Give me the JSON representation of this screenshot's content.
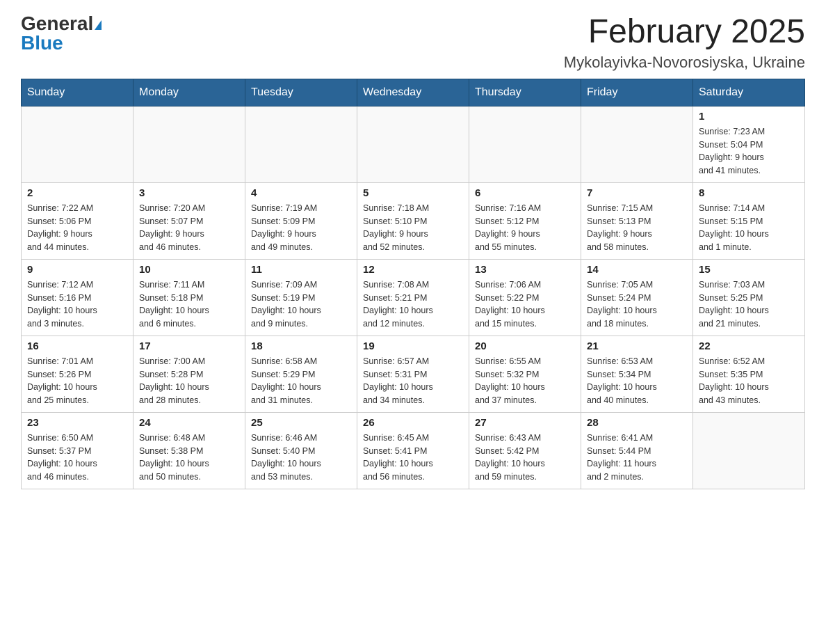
{
  "header": {
    "logo_general": "General",
    "logo_blue": "Blue",
    "title": "February 2025",
    "subtitle": "Mykolayivka-Novorosiyska, Ukraine"
  },
  "weekdays": [
    "Sunday",
    "Monday",
    "Tuesday",
    "Wednesday",
    "Thursday",
    "Friday",
    "Saturday"
  ],
  "weeks": [
    [
      {
        "day": "",
        "info": ""
      },
      {
        "day": "",
        "info": ""
      },
      {
        "day": "",
        "info": ""
      },
      {
        "day": "",
        "info": ""
      },
      {
        "day": "",
        "info": ""
      },
      {
        "day": "",
        "info": ""
      },
      {
        "day": "1",
        "info": "Sunrise: 7:23 AM\nSunset: 5:04 PM\nDaylight: 9 hours\nand 41 minutes."
      }
    ],
    [
      {
        "day": "2",
        "info": "Sunrise: 7:22 AM\nSunset: 5:06 PM\nDaylight: 9 hours\nand 44 minutes."
      },
      {
        "day": "3",
        "info": "Sunrise: 7:20 AM\nSunset: 5:07 PM\nDaylight: 9 hours\nand 46 minutes."
      },
      {
        "day": "4",
        "info": "Sunrise: 7:19 AM\nSunset: 5:09 PM\nDaylight: 9 hours\nand 49 minutes."
      },
      {
        "day": "5",
        "info": "Sunrise: 7:18 AM\nSunset: 5:10 PM\nDaylight: 9 hours\nand 52 minutes."
      },
      {
        "day": "6",
        "info": "Sunrise: 7:16 AM\nSunset: 5:12 PM\nDaylight: 9 hours\nand 55 minutes."
      },
      {
        "day": "7",
        "info": "Sunrise: 7:15 AM\nSunset: 5:13 PM\nDaylight: 9 hours\nand 58 minutes."
      },
      {
        "day": "8",
        "info": "Sunrise: 7:14 AM\nSunset: 5:15 PM\nDaylight: 10 hours\nand 1 minute."
      }
    ],
    [
      {
        "day": "9",
        "info": "Sunrise: 7:12 AM\nSunset: 5:16 PM\nDaylight: 10 hours\nand 3 minutes."
      },
      {
        "day": "10",
        "info": "Sunrise: 7:11 AM\nSunset: 5:18 PM\nDaylight: 10 hours\nand 6 minutes."
      },
      {
        "day": "11",
        "info": "Sunrise: 7:09 AM\nSunset: 5:19 PM\nDaylight: 10 hours\nand 9 minutes."
      },
      {
        "day": "12",
        "info": "Sunrise: 7:08 AM\nSunset: 5:21 PM\nDaylight: 10 hours\nand 12 minutes."
      },
      {
        "day": "13",
        "info": "Sunrise: 7:06 AM\nSunset: 5:22 PM\nDaylight: 10 hours\nand 15 minutes."
      },
      {
        "day": "14",
        "info": "Sunrise: 7:05 AM\nSunset: 5:24 PM\nDaylight: 10 hours\nand 18 minutes."
      },
      {
        "day": "15",
        "info": "Sunrise: 7:03 AM\nSunset: 5:25 PM\nDaylight: 10 hours\nand 21 minutes."
      }
    ],
    [
      {
        "day": "16",
        "info": "Sunrise: 7:01 AM\nSunset: 5:26 PM\nDaylight: 10 hours\nand 25 minutes."
      },
      {
        "day": "17",
        "info": "Sunrise: 7:00 AM\nSunset: 5:28 PM\nDaylight: 10 hours\nand 28 minutes."
      },
      {
        "day": "18",
        "info": "Sunrise: 6:58 AM\nSunset: 5:29 PM\nDaylight: 10 hours\nand 31 minutes."
      },
      {
        "day": "19",
        "info": "Sunrise: 6:57 AM\nSunset: 5:31 PM\nDaylight: 10 hours\nand 34 minutes."
      },
      {
        "day": "20",
        "info": "Sunrise: 6:55 AM\nSunset: 5:32 PM\nDaylight: 10 hours\nand 37 minutes."
      },
      {
        "day": "21",
        "info": "Sunrise: 6:53 AM\nSunset: 5:34 PM\nDaylight: 10 hours\nand 40 minutes."
      },
      {
        "day": "22",
        "info": "Sunrise: 6:52 AM\nSunset: 5:35 PM\nDaylight: 10 hours\nand 43 minutes."
      }
    ],
    [
      {
        "day": "23",
        "info": "Sunrise: 6:50 AM\nSunset: 5:37 PM\nDaylight: 10 hours\nand 46 minutes."
      },
      {
        "day": "24",
        "info": "Sunrise: 6:48 AM\nSunset: 5:38 PM\nDaylight: 10 hours\nand 50 minutes."
      },
      {
        "day": "25",
        "info": "Sunrise: 6:46 AM\nSunset: 5:40 PM\nDaylight: 10 hours\nand 53 minutes."
      },
      {
        "day": "26",
        "info": "Sunrise: 6:45 AM\nSunset: 5:41 PM\nDaylight: 10 hours\nand 56 minutes."
      },
      {
        "day": "27",
        "info": "Sunrise: 6:43 AM\nSunset: 5:42 PM\nDaylight: 10 hours\nand 59 minutes."
      },
      {
        "day": "28",
        "info": "Sunrise: 6:41 AM\nSunset: 5:44 PM\nDaylight: 11 hours\nand 2 minutes."
      },
      {
        "day": "",
        "info": ""
      }
    ]
  ]
}
